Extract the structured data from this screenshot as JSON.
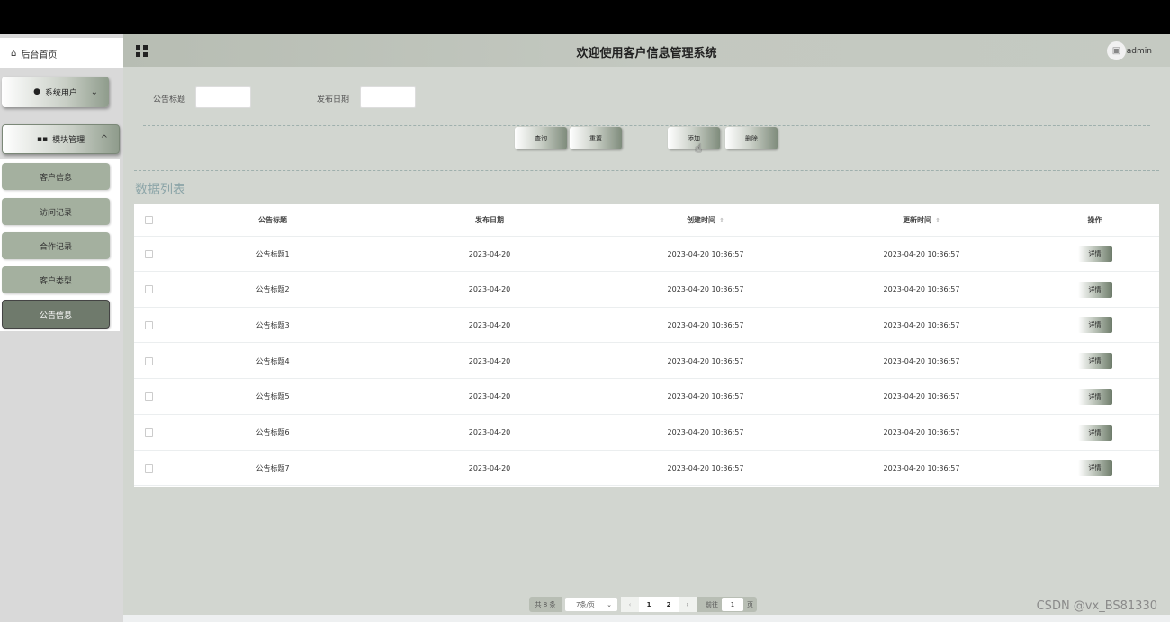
{
  "sidebar": {
    "home_label": "后台首页",
    "user_menu_label": "系统用户",
    "module_menu_label": "模块管理",
    "sub_items": [
      "客户信息",
      "访问记录",
      "合作记录",
      "客户类型",
      "公告信息"
    ],
    "active_sub_item": "公告信息"
  },
  "header": {
    "title": "欢迎使用客户信息管理系统",
    "username": "admin"
  },
  "search": {
    "title_label": "公告标题",
    "title_value": "",
    "date_label": "发布日期",
    "date_value": ""
  },
  "actions": {
    "query": "查询",
    "reset": "重置",
    "add": "添加",
    "delete": "删除"
  },
  "list": {
    "title": "数据列表",
    "columns": [
      "公告标题",
      "发布日期",
      "创建时间",
      "更新时间",
      "操作"
    ],
    "rows": [
      {
        "title": "公告标题1",
        "date": "2023-04-20",
        "created": "2023-04-20 10:36:57",
        "updated": "2023-04-20 10:36:57",
        "action": "详情"
      },
      {
        "title": "公告标题2",
        "date": "2023-04-20",
        "created": "2023-04-20 10:36:57",
        "updated": "2023-04-20 10:36:57",
        "action": "详情"
      },
      {
        "title": "公告标题3",
        "date": "2023-04-20",
        "created": "2023-04-20 10:36:57",
        "updated": "2023-04-20 10:36:57",
        "action": "详情"
      },
      {
        "title": "公告标题4",
        "date": "2023-04-20",
        "created": "2023-04-20 10:36:57",
        "updated": "2023-04-20 10:36:57",
        "action": "详情"
      },
      {
        "title": "公告标题5",
        "date": "2023-04-20",
        "created": "2023-04-20 10:36:57",
        "updated": "2023-04-20 10:36:57",
        "action": "详情"
      },
      {
        "title": "公告标题6",
        "date": "2023-04-20",
        "created": "2023-04-20 10:36:57",
        "updated": "2023-04-20 10:36:57",
        "action": "详情"
      },
      {
        "title": "公告标题7",
        "date": "2023-04-20",
        "created": "2023-04-20 10:36:57",
        "updated": "2023-04-20 10:36:57",
        "action": "详情"
      }
    ]
  },
  "pagination": {
    "total": "共 8 条",
    "page_size": "7条/页",
    "pages": [
      "1",
      "2"
    ],
    "current_page": "1",
    "goto_label": "前往",
    "goto_value": "1",
    "page_suffix": "页"
  },
  "watermark": "CSDN @vx_BS81330",
  "colors": {
    "background": "#d2d6d0",
    "sidebar_sub_item": "#a4b09f",
    "sidebar_active": "#6f7a6c",
    "list_title": "#8ca5a8"
  },
  "icons": {
    "home": "home-icon",
    "user": "user-icon",
    "module": "grid-icon",
    "avatar": "image-icon"
  }
}
